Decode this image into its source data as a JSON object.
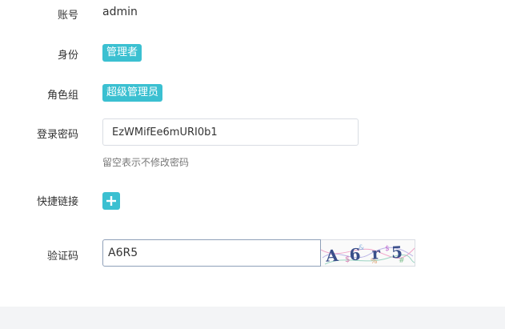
{
  "form": {
    "account": {
      "label": "账号",
      "value": "admin"
    },
    "identity": {
      "label": "身份",
      "badge": "管理者"
    },
    "role_group": {
      "label": "角色组",
      "badge": "超级管理员"
    },
    "password": {
      "label": "登录密码",
      "value": "EzWMifEe6mURI0b1",
      "help": "留空表示不修改密码"
    },
    "shortcut": {
      "label": "快捷链接",
      "add_icon": "plus-icon"
    },
    "captcha": {
      "label": "验证码",
      "value": "A6R5",
      "image_text": "A6r5"
    }
  },
  "colors": {
    "accent": "#3bc0d1",
    "footer_bg": "#f3f4f6",
    "captcha_border": "#8fa0b8"
  }
}
